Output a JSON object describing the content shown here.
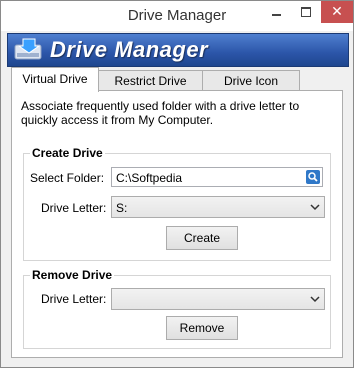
{
  "window": {
    "title": "Drive Manager",
    "controls": {
      "minimize": "minimize",
      "maximize": "maximize",
      "close": "✕"
    }
  },
  "banner": {
    "title": "Drive Manager",
    "icon": "drive-icon"
  },
  "tabs": [
    {
      "label": "Virtual Drive",
      "active": true
    },
    {
      "label": "Restrict Drive",
      "active": false
    },
    {
      "label": "Drive Icon",
      "active": false
    }
  ],
  "panel": {
    "description": "Associate frequently used folder with a drive letter to quickly access it from My Computer."
  },
  "create_drive": {
    "title": "Create Drive",
    "folder_label": "Select Folder:",
    "folder_value": "C:\\Softpedia",
    "drive_letter_label": "Drive Letter:",
    "drive_letter_value": "S:",
    "button_label": "Create"
  },
  "remove_drive": {
    "title": "Remove Drive",
    "drive_letter_label": "Drive Letter:",
    "drive_letter_value": "",
    "button_label": "Remove"
  },
  "colors": {
    "banner": "#2b55a8",
    "close": "#c75050",
    "browse": "#2f78c8"
  }
}
